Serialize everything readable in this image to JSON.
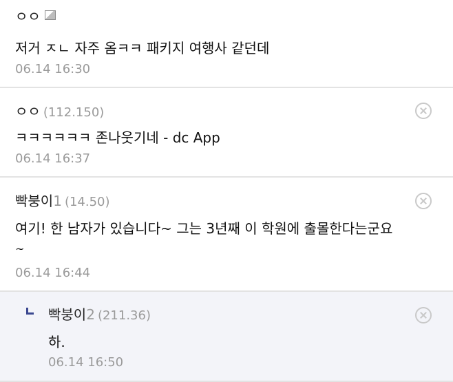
{
  "comments": [
    {
      "name": "ㅇㅇ",
      "name_suffix": "",
      "ip": "",
      "text": "저거 ㅈㄴ 자주 옴ㅋㅋ 패키지 여행사 같던데",
      "text2": "",
      "time": "06.14 16:30",
      "has_image_icon": true,
      "has_delete": false
    },
    {
      "name": "ㅇㅇ",
      "name_suffix": "",
      "ip": "(112.150)",
      "text": "ㅋㅋㅋㅋㅋㅋ 존나웃기네 - dc App",
      "text2": "",
      "time": "06.14 16:37",
      "has_image_icon": false,
      "has_delete": true
    },
    {
      "name": "빡붕이",
      "name_suffix": "1",
      "ip": "(14.50)",
      "text": "여기! 한 남자가 있습니다~ 그는 3년째 이 학원에 출몰한다는군요",
      "text2": "~",
      "time": "06.14 16:44",
      "has_image_icon": false,
      "has_delete": true
    }
  ],
  "reply": {
    "name": "빡붕이",
    "name_suffix": "2",
    "ip": "(211.36)",
    "text": "하.",
    "time": "06.14 16:50",
    "has_delete": true
  }
}
